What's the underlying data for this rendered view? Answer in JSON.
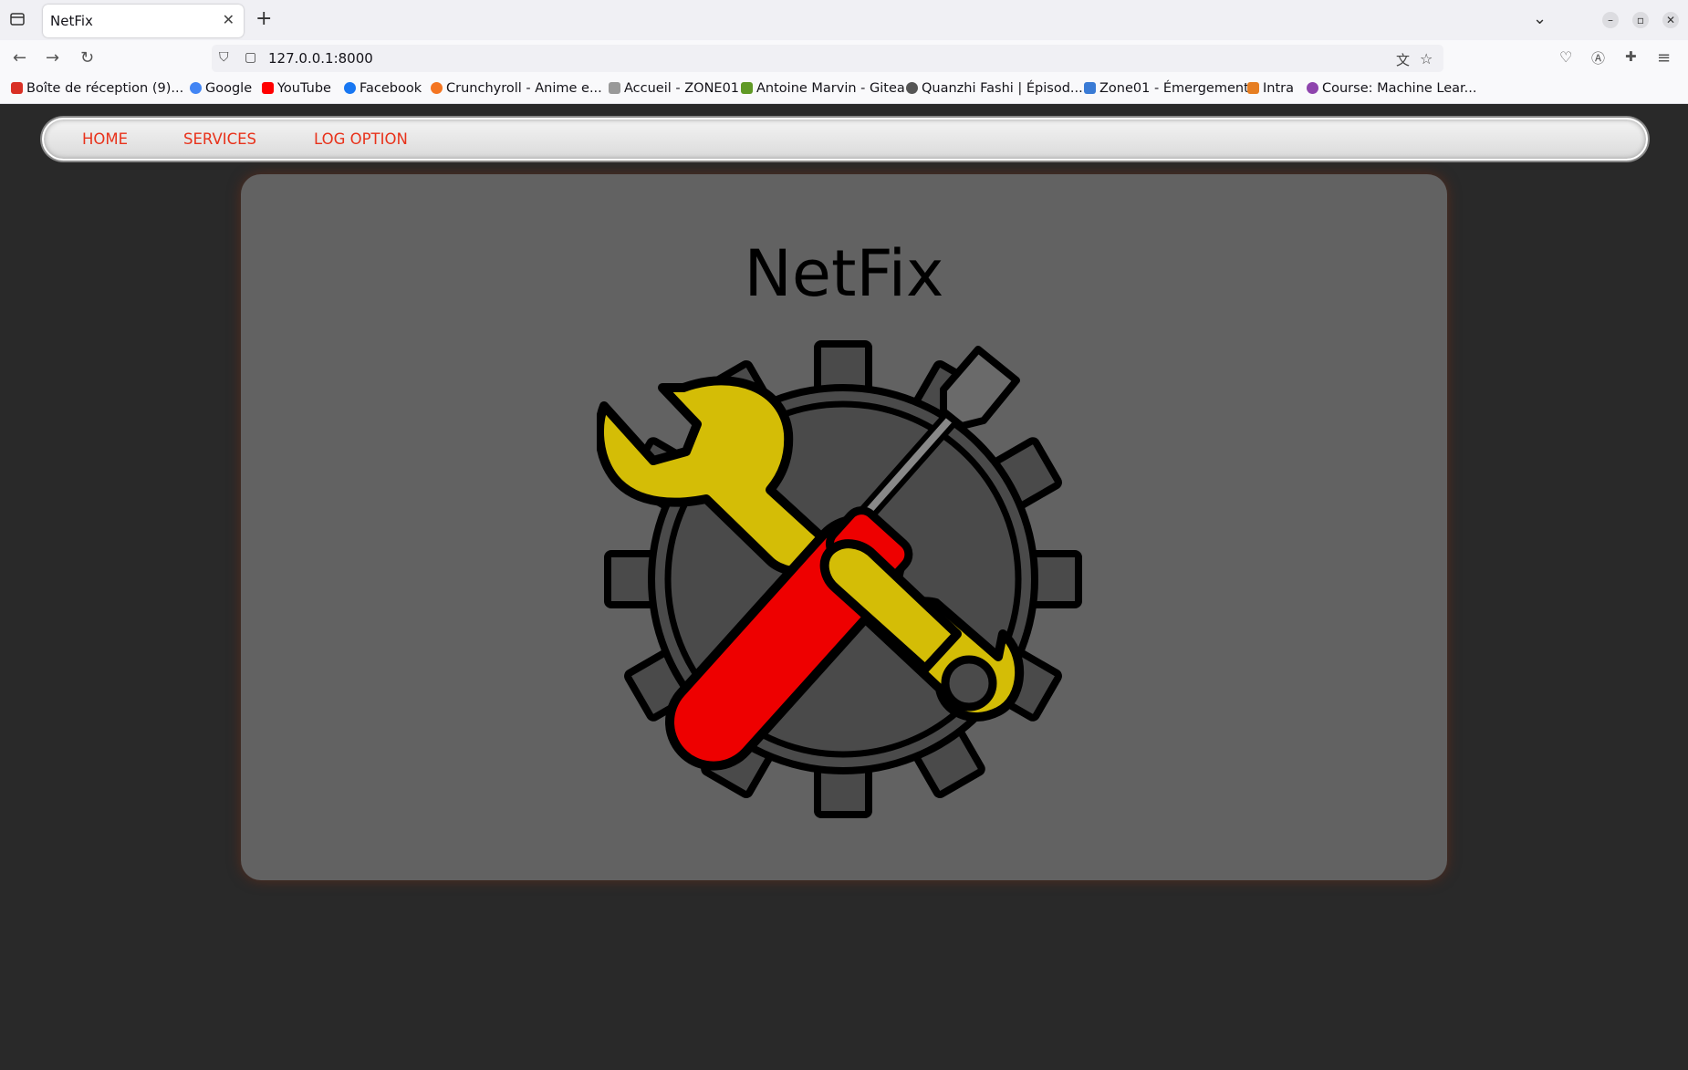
{
  "browser": {
    "tab_title": "NetFix",
    "url": "127.0.0.1:8000",
    "bookmarks": [
      {
        "label": "Boîte de réception (9)...",
        "icon_color": "#d93025"
      },
      {
        "label": "Google",
        "icon_color": "#4285f4"
      },
      {
        "label": "YouTube",
        "icon_color": "#ff0000"
      },
      {
        "label": "Facebook",
        "icon_color": "#1877f2"
      },
      {
        "label": "Crunchyroll - Anime e...",
        "icon_color": "#f47521"
      },
      {
        "label": "Accueil - ZONE01",
        "icon_color": "#999999"
      },
      {
        "label": "Antoine Marvin - Gitea",
        "icon_color": "#609926"
      },
      {
        "label": "Quanzhi Fashi | Épisod...",
        "icon_color": "#555555"
      },
      {
        "label": "Zone01 - Émergement",
        "icon_color": "#3a7bd5"
      },
      {
        "label": "Intra",
        "icon_color": "#e67e22"
      },
      {
        "label": "Course: Machine Lear...",
        "icon_color": "#8e44ad"
      }
    ]
  },
  "menu": {
    "home": "HOME",
    "services": "SERVICES",
    "log_option": "LOG OPTION"
  },
  "hero": {
    "title": "NetFix",
    "logo_icon": "gear-wrench-screwdriver-icon"
  },
  "colors": {
    "page_bg": "#292929",
    "card_bg": "#626262",
    "menu_link": "#e8321b",
    "wrench": "#d4bd06",
    "screwdriver_handle": "#ee0000",
    "gear": "#4a4a4a"
  }
}
